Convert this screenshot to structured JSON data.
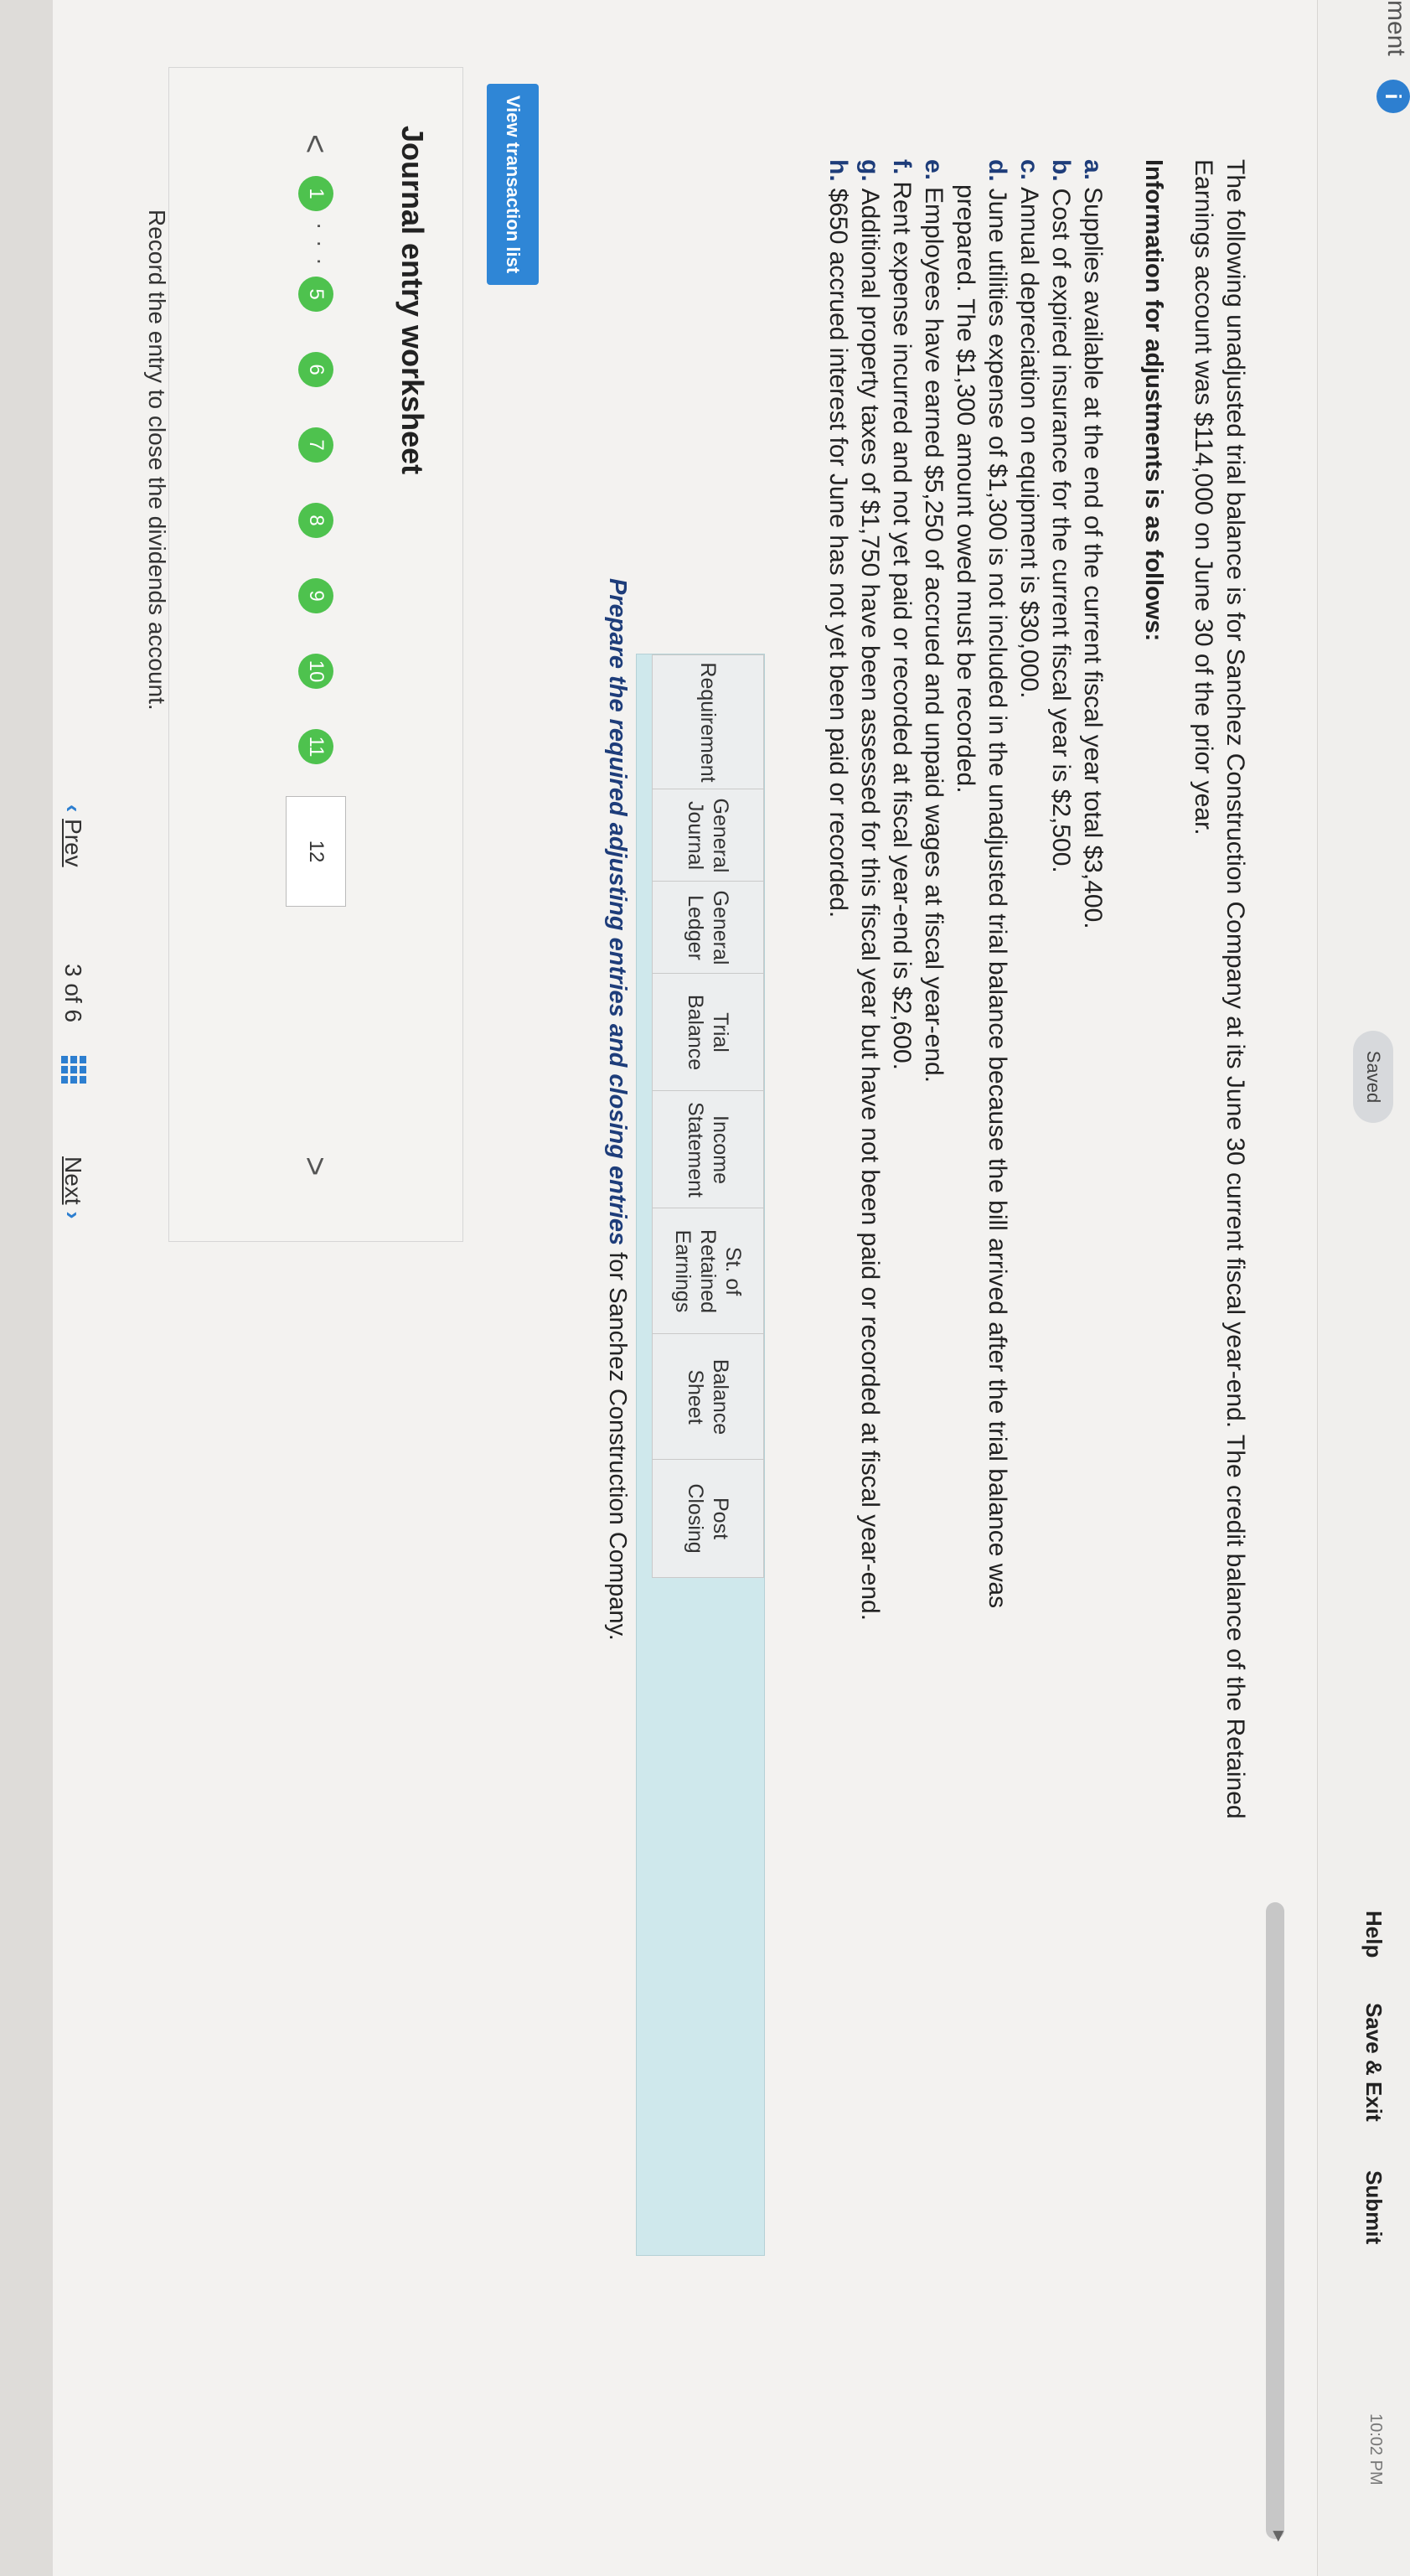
{
  "header": {
    "title_fragment": "ment",
    "info_badge": "i",
    "saved": "Saved",
    "help": "Help",
    "save_exit": "Save & Exit",
    "submit": "Submit",
    "time": "10:02 PM"
  },
  "intro": {
    "text": "The following unadjusted trial balance is for Sanchez Construction Company at its June 30 current fiscal year-end. The credit balance of the Retained Earnings account was $114,000 on June 30 of the prior year.",
    "heading": "Information for adjustments is as follows:"
  },
  "adjustments": [
    {
      "letter": "a.",
      "text": "Supplies available at the end of the current fiscal year total $3,400."
    },
    {
      "letter": "b.",
      "text": "Cost of expired insurance for the current fiscal year is $2,500."
    },
    {
      "letter": "c.",
      "text": "Annual depreciation on equipment is $30,000."
    },
    {
      "letter": "d.",
      "text": "June utilities expense of $1,300 is not included in the unadjusted trial balance because the bill arrived after the trial balance was",
      "cont": "prepared. The $1,300 amount owed must be recorded."
    },
    {
      "letter": "e.",
      "text": "Employees have earned $5,250 of accrued and unpaid wages at fiscal year-end."
    },
    {
      "letter": "f.",
      "text": "Rent expense incurred and not yet paid or recorded at fiscal year-end is $2,600."
    },
    {
      "letter": "g.",
      "text": "Additional property taxes of $1,750 have been assessed for this fiscal year but have not been paid or recorded at fiscal year-end."
    },
    {
      "letter": "h.",
      "text": "$650 accrued interest for June has not yet been paid or recorded."
    }
  ],
  "tabs": [
    {
      "label": "Requirement"
    },
    {
      "label": "General Journal"
    },
    {
      "label": "General Ledger"
    },
    {
      "label": "Trial Balance"
    },
    {
      "label": "Income Statement"
    },
    {
      "label": "St. of Retained Earnings"
    },
    {
      "label": "Balance Sheet"
    },
    {
      "label": "Post Closing"
    }
  ],
  "prepare": {
    "em": "Prepare the required adjusting entries and closing entries",
    "rest": " for Sanchez Construction Company."
  },
  "view_button": "View transaction list",
  "worksheet": {
    "title": "Journal entry worksheet",
    "prev": "<",
    "next": ">",
    "dots": "· · · · ·",
    "steps": [
      "1",
      "5",
      "6",
      "7",
      "8",
      "9",
      "10",
      "11",
      "12"
    ],
    "instruction": "Record the entry to close the dividends account."
  },
  "footer": {
    "prev": "Prev",
    "page": "3",
    "of": "of 6",
    "next": "Next"
  }
}
